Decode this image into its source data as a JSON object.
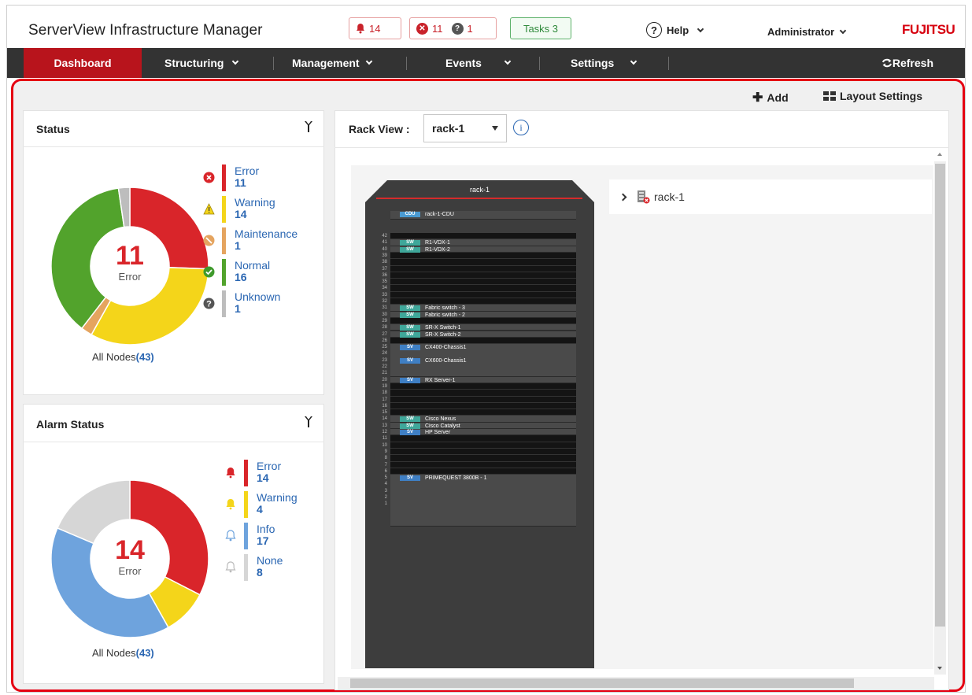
{
  "header": {
    "app_title": "ServerView Infrastructure Manager",
    "alarm_badge": "14",
    "error_badge": "11",
    "unknown_badge": "1",
    "tasks_badge": "Tasks 3",
    "help_label": "Help",
    "user_label": "Administrator",
    "logo": "FUJITSU"
  },
  "nav": {
    "items": [
      {
        "label": "Dashboard"
      },
      {
        "label": "Structuring"
      },
      {
        "label": "Management"
      },
      {
        "label": "Events"
      },
      {
        "label": "Settings"
      }
    ],
    "refresh_label": "Refresh"
  },
  "toolbar": {
    "add_label": "Add",
    "layout_label": "Layout Settings"
  },
  "status_panel": {
    "title": "Status",
    "center_value": "11",
    "center_label": "Error",
    "all_nodes_label": "All Nodes",
    "all_nodes_count": "(43)",
    "legend": [
      {
        "label": "Error",
        "count": "11",
        "color": "#d9252a"
      },
      {
        "label": "Warning",
        "count": "14",
        "color": "#f4d51a"
      },
      {
        "label": "Maintenance",
        "count": "1",
        "color": "#e5a45f"
      },
      {
        "label": "Normal",
        "count": "16",
        "color": "#52a32c"
      },
      {
        "label": "Unknown",
        "count": "1",
        "color": "#bdbdbd"
      }
    ]
  },
  "alarm_panel": {
    "title": "Alarm Status",
    "center_value": "14",
    "center_label": "Error",
    "all_nodes_label": "All Nodes",
    "all_nodes_count": "(43)",
    "legend": [
      {
        "label": "Error",
        "count": "14",
        "color": "#d9252a"
      },
      {
        "label": "Warning",
        "count": "4",
        "color": "#f4d51a"
      },
      {
        "label": "Info",
        "count": "17",
        "color": "#6ea3dd"
      },
      {
        "label": "None",
        "count": "8",
        "color": "#d6d6d6"
      }
    ]
  },
  "rack_view": {
    "label": "Rack View :",
    "selected": "rack-1",
    "rack_title": "rack-1",
    "tree_root": "rack-1",
    "cdu": {
      "tag": "CDU",
      "name": "rack-1-CDU"
    },
    "devices": [
      {
        "u": 41,
        "tag": "SW",
        "name": "R1-VDX-1"
      },
      {
        "u": 40,
        "tag": "SW",
        "name": "R1-VDX-2"
      },
      {
        "u": 31,
        "tag": "SW",
        "name": "Fabric switch - 3"
      },
      {
        "u": 30,
        "tag": "SW",
        "name": "Fabric switch - 2"
      },
      {
        "u": 28,
        "tag": "SW",
        "name": "SR-X Switch-1"
      },
      {
        "u": 27,
        "tag": "SW",
        "name": "SR-X Switch-2"
      },
      {
        "u": 25,
        "tag": "SV",
        "name": "CX400-Chassis1"
      },
      {
        "u": 23,
        "tag": "SV",
        "name": "CX600-Chassis1"
      },
      {
        "u": 20,
        "tag": "SV",
        "name": "RX Server-1"
      },
      {
        "u": 14,
        "tag": "SW",
        "name": "Cisco Nexus"
      },
      {
        "u": 13,
        "tag": "SW",
        "name": "Cisco Catalyst"
      },
      {
        "u": 12,
        "tag": "SV",
        "name": "HP Server"
      },
      {
        "u": 5,
        "tag": "SV",
        "name": "PRIMEQUEST 3800B - 1"
      }
    ]
  }
}
